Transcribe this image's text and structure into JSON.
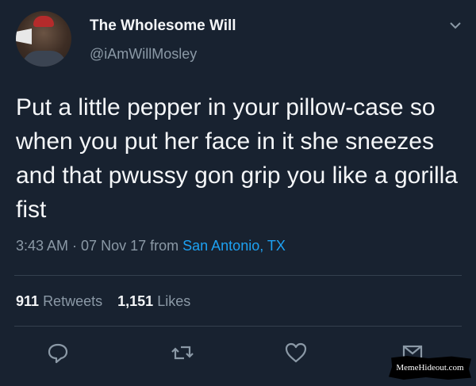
{
  "tweet": {
    "display_name": "The Wholesome Will",
    "handle": "@iAmWillMosley",
    "text": "Put a little pepper in your pillow-case so when you put her face in it she sneezes and that pwussy gon grip you like a gorilla fist",
    "time": "3:43 AM",
    "separator": " · ",
    "date": "07 Nov 17",
    "from_prefix": " from ",
    "location": "San Antonio, TX"
  },
  "stats": {
    "retweets_count": "911",
    "retweets_label": "Retweets",
    "likes_count": "1,151",
    "likes_label": "Likes"
  },
  "actions": [
    "reply-icon",
    "retweet-icon",
    "like-icon",
    "message-icon"
  ],
  "watermark": "MemeHideout.com",
  "colors": {
    "background": "#182230",
    "text": "#f4f6f8",
    "muted": "#8b99a6",
    "link": "#1da1f2"
  }
}
